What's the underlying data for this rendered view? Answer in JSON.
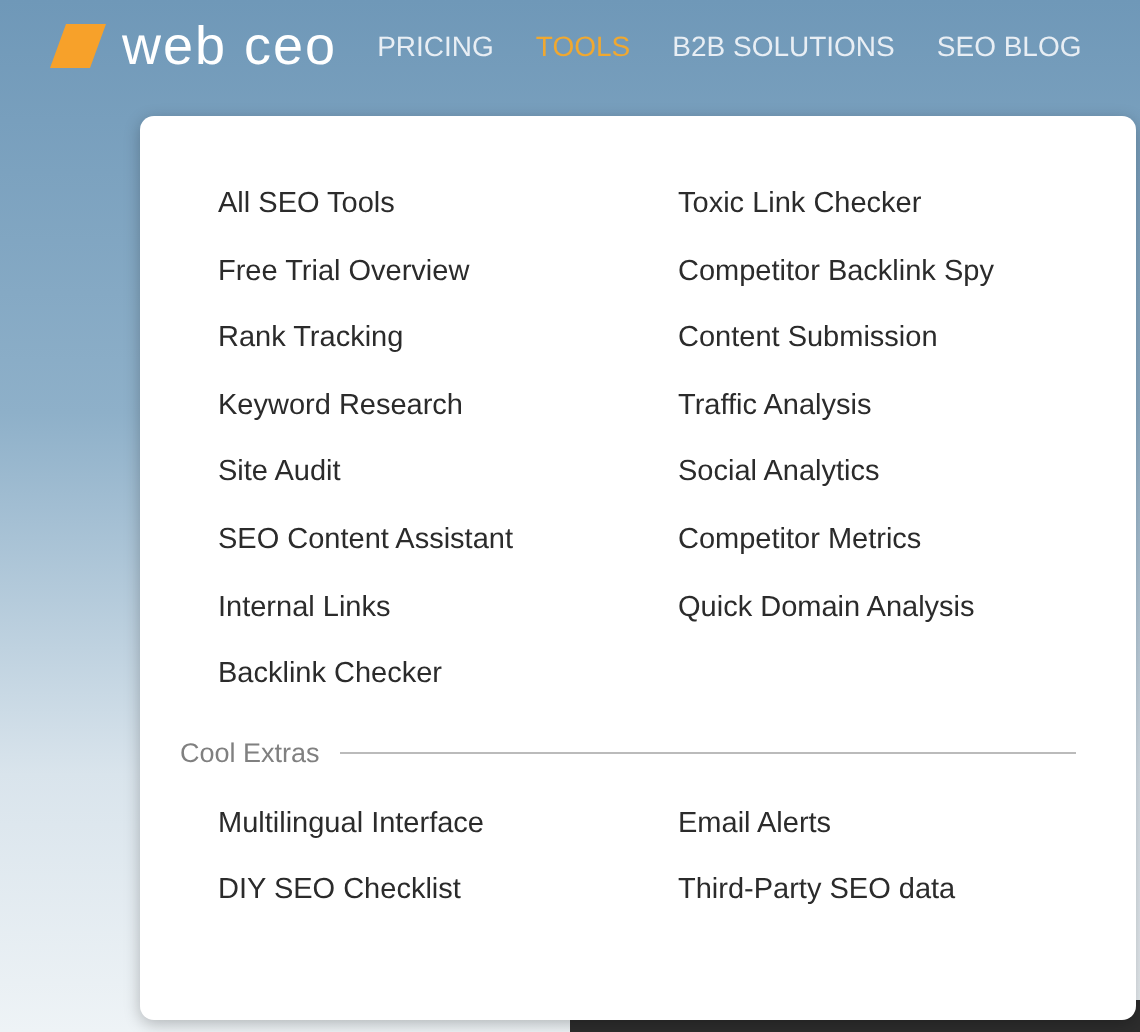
{
  "header": {
    "logo": "web ceo",
    "nav": [
      {
        "label": "PRICING",
        "selected": false
      },
      {
        "label": "TOOLS",
        "selected": true
      },
      {
        "label": "B2B SOLUTIONS",
        "selected": false
      },
      {
        "label": "SEO BLOG",
        "selected": false
      }
    ]
  },
  "menu": {
    "columns": [
      [
        "All SEO Tools",
        "Free Trial Overview",
        "Rank Tracking",
        "Keyword Research",
        "Site Audit",
        "SEO Content Assistant",
        "Internal Links",
        "Backlink Checker"
      ],
      [
        "Toxic Link Checker",
        "Competitor Backlink Spy",
        "Content Submission",
        "Traffic Analysis",
        "Social Analytics",
        "Competitor Metrics",
        "Quick Domain Analysis"
      ]
    ],
    "extras": {
      "title": "Cool Extras",
      "columns": [
        [
          "Multilingual Interface",
          "DIY SEO Checklist"
        ],
        [
          "Email Alerts",
          "Third-Party SEO data"
        ]
      ]
    }
  }
}
